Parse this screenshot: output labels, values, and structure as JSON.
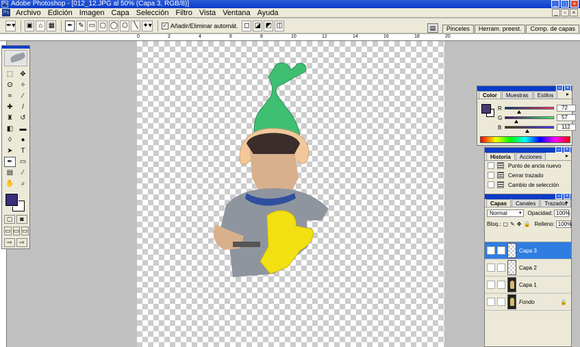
{
  "window": {
    "title": "Adobe Photoshop - [012_12.JPG al 50% (Capa 3, RGB/8)]",
    "app_icon": "Ps",
    "controls": [
      "_",
      "□",
      "×"
    ],
    "doc_controls": [
      "_",
      "▫",
      "×"
    ]
  },
  "menu": [
    "Archivo",
    "Edición",
    "Imagen",
    "Capa",
    "Selección",
    "Filtro",
    "Vista",
    "Ventana",
    "Ayuda"
  ],
  "options_bar": {
    "auto_add_delete_label": "Añadir/Eliminar automát.",
    "auto_add_delete_checked": true,
    "check_glyph": "✓"
  },
  "palette_well": {
    "tabs": [
      "Pinceles",
      "Herram. preest.",
      "Comp. de capas"
    ]
  },
  "ruler": {
    "labels": [
      "0",
      "2",
      "4",
      "6",
      "8",
      "10",
      "12",
      "14",
      "16",
      "18",
      "20"
    ]
  },
  "toolbox": {
    "tools": [
      {
        "name": "marquee-tool-icon",
        "glyph": "⬚"
      },
      {
        "name": "move-tool-icon",
        "glyph": "✥"
      },
      {
        "name": "lasso-tool-icon",
        "glyph": "ʘ"
      },
      {
        "name": "magic-wand-tool-icon",
        "glyph": "✧"
      },
      {
        "name": "crop-tool-icon",
        "glyph": "⌗"
      },
      {
        "name": "slice-tool-icon",
        "glyph": "⁄"
      },
      {
        "name": "healing-brush-tool-icon",
        "glyph": "✚"
      },
      {
        "name": "brush-tool-icon",
        "glyph": "/"
      },
      {
        "name": "clone-stamp-tool-icon",
        "glyph": "♜"
      },
      {
        "name": "history-brush-tool-icon",
        "glyph": "↺"
      },
      {
        "name": "eraser-tool-icon",
        "glyph": "◧"
      },
      {
        "name": "gradient-tool-icon",
        "glyph": "▬"
      },
      {
        "name": "blur-tool-icon",
        "glyph": "◊"
      },
      {
        "name": "dodge-tool-icon",
        "glyph": "●"
      },
      {
        "name": "path-selection-tool-icon",
        "glyph": "➤"
      },
      {
        "name": "type-tool-icon",
        "glyph": "T"
      },
      {
        "name": "pen-tool-icon",
        "glyph": "✒"
      },
      {
        "name": "shape-tool-icon",
        "glyph": "▭"
      },
      {
        "name": "notes-tool-icon",
        "glyph": "▤"
      },
      {
        "name": "eyedropper-tool-icon",
        "glyph": "⁄"
      },
      {
        "name": "hand-tool-icon",
        "glyph": "✋"
      },
      {
        "name": "zoom-tool-icon",
        "glyph": "⌕"
      }
    ],
    "selected_tool": 16,
    "foreground_color": "#3b2e78",
    "background_color": "#ffffff",
    "mode_buttons": [
      "▢",
      "◙"
    ],
    "screen_buttons": [
      "▭",
      "▭",
      "▭"
    ],
    "jump_buttons": [
      "⇨",
      "⇨"
    ]
  },
  "color_panel": {
    "tabs": [
      "Color",
      "Muestras",
      "Estilos"
    ],
    "menu_glyph": "▸",
    "swatch": "#483970",
    "channels": [
      {
        "label": "R",
        "value": "72",
        "level": 0.282,
        "gradient": "linear-gradient(90deg,#003970,#ff3970)"
      },
      {
        "label": "G",
        "value": "57",
        "level": 0.224,
        "gradient": "linear-gradient(90deg,#480070,#48ff70)"
      },
      {
        "label": "B",
        "value": "112",
        "level": 0.439,
        "gradient": "linear-gradient(90deg,#483900,#4839ff)"
      }
    ]
  },
  "history_panel": {
    "tabs": [
      "Historia",
      "Acciones"
    ],
    "items": [
      "Punto de ancla nuevo",
      "Cerrar trazado",
      "Cambio de selección"
    ]
  },
  "layers_panel": {
    "tabs": [
      "Capas",
      "Canales",
      "Trazados"
    ],
    "blend_mode": "Normal",
    "opacity_label": "Opacidad:",
    "opacity": "100%",
    "lock_label": "Bloq.:",
    "fill_label": "Relleno:",
    "fill": "100%",
    "lock_glyphs": [
      "▢",
      "✎",
      "✥",
      "🔒"
    ],
    "lock_icon": "🔒",
    "layers": [
      {
        "name": "Capa 3",
        "visible": true,
        "selected": true,
        "thumb": "checker",
        "italic": false
      },
      {
        "name": "Capa 2",
        "visible": false,
        "selected": false,
        "thumb": "checker",
        "italic": false
      },
      {
        "name": "Capa 1",
        "visible": false,
        "selected": false,
        "thumb": "img",
        "italic": false
      },
      {
        "name": "Fondo",
        "visible": false,
        "selected": false,
        "thumb": "img",
        "italic": true,
        "locked": true
      }
    ]
  }
}
